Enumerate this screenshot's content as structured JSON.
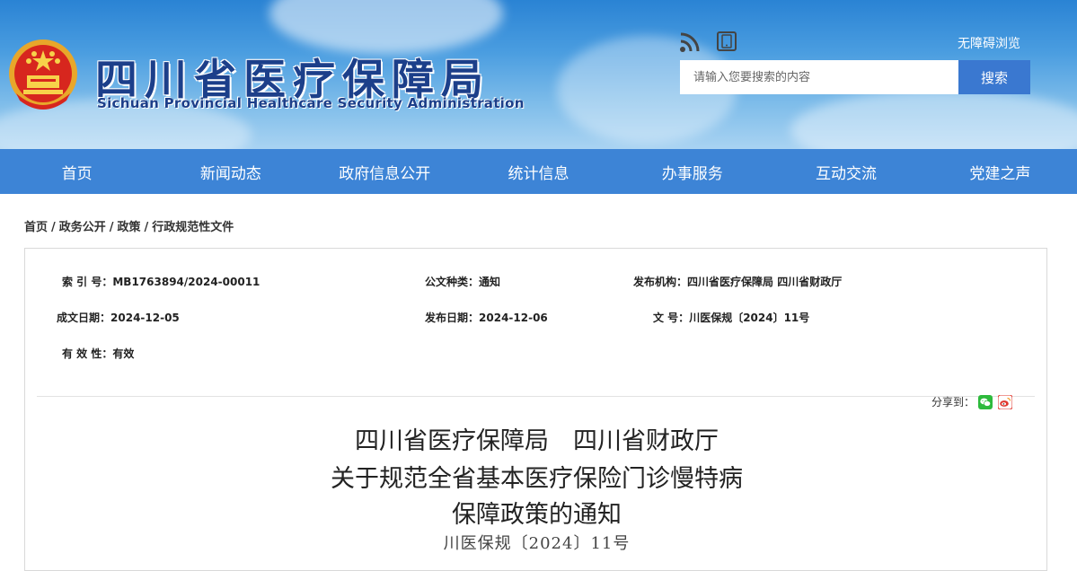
{
  "header": {
    "title_cn": "四川省医疗保障局",
    "title_en": "Sichuan Provincial Healthcare Security Administration",
    "accessibility_label": "无障碍浏览",
    "search": {
      "placeholder": "请输入您要搜索的内容",
      "button_label": "搜索"
    },
    "icons": [
      "national-emblem-icon",
      "rss-icon",
      "mobile-icon"
    ]
  },
  "nav": {
    "items": [
      "首页",
      "新闻动态",
      "政府信息公开",
      "统计信息",
      "办事服务",
      "互动交流",
      "党建之声"
    ]
  },
  "breadcrumb": [
    "首页",
    "政务公开",
    "政策",
    "行政规范性文件"
  ],
  "meta": {
    "index_label": "索 引 号：",
    "index_value": "MB1763894/2024-00011",
    "type_label": "公文种类：",
    "type_value": "通知",
    "issuer_label": "发布机构：",
    "issuer_value": "四川省医疗保障局 四川省财政厅",
    "created_label": "成文日期：",
    "created_value": "2024-12-05",
    "published_label": "发布日期：",
    "published_value": "2024-12-06",
    "docno_label": "文 号：",
    "docno_value": "川医保规〔2024〕11号",
    "validity_label": "有 效 性：",
    "validity_value": "有效"
  },
  "share": {
    "label": "分享到：",
    "icons": [
      "wechat-icon",
      "weibo-icon"
    ]
  },
  "document": {
    "title_lines": [
      "四川省医疗保障局　四川省财政厅",
      "关于规范全省基本医疗保险门诊慢特病",
      "保障政策的通知"
    ],
    "doc_number": "川医保规〔2024〕11号"
  },
  "colors": {
    "nav_bg": "#3d84d6",
    "title_blue": "#1c3f8a",
    "search_button": "#3a78d0"
  }
}
